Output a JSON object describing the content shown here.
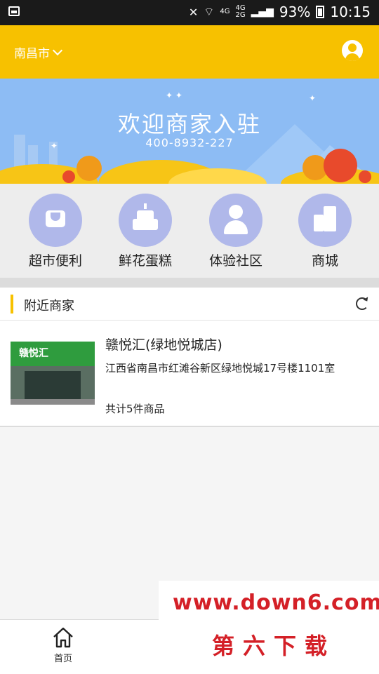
{
  "status_bar": {
    "network_small": "4G",
    "network_small2": "4G",
    "network_small3": "2G",
    "battery": "93%",
    "time": "10:15"
  },
  "header": {
    "city": "南昌市"
  },
  "banner": {
    "title": "欢迎商家入驻",
    "phone": "400-8932-227"
  },
  "categories": [
    {
      "label": "超市便利",
      "icon": "shop-bag-icon"
    },
    {
      "label": "鲜花蛋糕",
      "icon": "cake-icon"
    },
    {
      "label": "体验社区",
      "icon": "person-icon"
    },
    {
      "label": "商城",
      "icon": "buildings-icon"
    }
  ],
  "nearby": {
    "title": "附近商家"
  },
  "stores": [
    {
      "name": "赣悦汇(绿地悦城店)",
      "address": "江西省南昌市红滩谷新区绿地悦城17号楼1101室",
      "count": "共计5件商品",
      "sign": "赣悦汇"
    }
  ],
  "tabbar": {
    "home": "首页"
  },
  "watermark": {
    "url": "www.down6.com",
    "name": "第六下载"
  },
  "colors": {
    "brand": "#f7c100",
    "icon_bg": "#b0b8ea",
    "banner": "#8dbcf4",
    "watermark": "#d42027"
  }
}
